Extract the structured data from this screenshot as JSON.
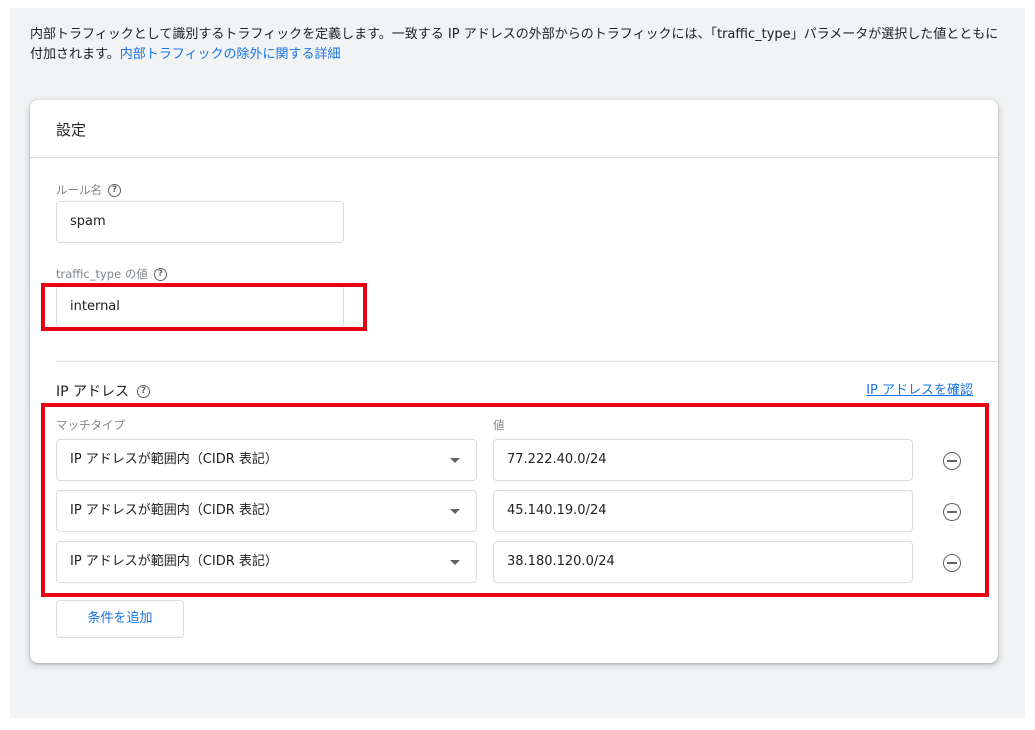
{
  "intro": {
    "text": "内部トラフィックとして識別するトラフィックを定義します。一致する IP アドレスの外部からのトラフィックには、「traffic_type」パラメータが選択した値とともに付加されます。",
    "link": "内部トラフィックの除外に関する詳細"
  },
  "card": {
    "title": "設定",
    "rule_name": {
      "label": "ルール名",
      "value": "spam"
    },
    "traffic_type": {
      "label": "traffic_type の値",
      "value": "internal"
    },
    "ip_section": {
      "title": "IP アドレス",
      "verify_link": "IP アドレスを確認",
      "match_type_label": "マッチタイプ",
      "value_label": "値",
      "rows": [
        {
          "match_type": "IP アドレスが範囲内（CIDR 表記）",
          "value": "77.222.40.0/24"
        },
        {
          "match_type": "IP アドレスが範囲内（CIDR 表記）",
          "value": "45.140.19.0/24"
        },
        {
          "match_type": "IP アドレスが範囲内（CIDR 表記）",
          "value": "38.180.120.0/24"
        }
      ]
    },
    "add_condition": "条件を追加"
  },
  "colors": {
    "highlight": "#e60012",
    "link": "#1a73e8",
    "background": "#f1f3f4"
  },
  "icons": [
    "help-icon",
    "dropdown-arrow-icon",
    "remove-circle-icon"
  ]
}
